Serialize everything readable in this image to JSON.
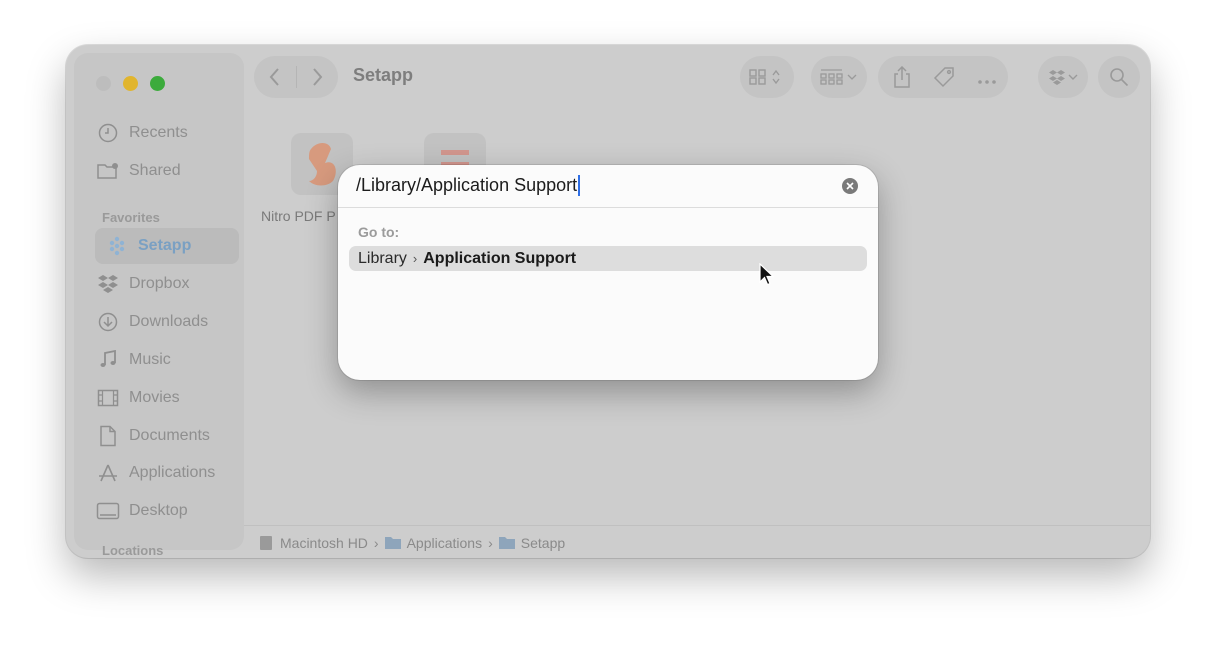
{
  "window": {
    "title": "Setapp",
    "colors": {
      "close": "#bdbdbd",
      "minimize": "#e1b52e",
      "maximize": "#3cab3c"
    }
  },
  "sidebar": {
    "items_top": [
      {
        "label": "Recents",
        "icon": "clock-icon"
      },
      {
        "label": "Shared",
        "icon": "shared-folder-icon"
      }
    ],
    "favorites_header": "Favorites",
    "favorites": [
      {
        "label": "Setapp",
        "icon": "setapp-icon",
        "active": true
      },
      {
        "label": "Dropbox",
        "icon": "dropbox-icon"
      },
      {
        "label": "Downloads",
        "icon": "download-icon"
      },
      {
        "label": "Music",
        "icon": "music-note-icon"
      },
      {
        "label": "Movies",
        "icon": "film-icon"
      },
      {
        "label": "Documents",
        "icon": "document-icon"
      },
      {
        "label": "Applications",
        "icon": "applications-icon"
      },
      {
        "label": "Desktop",
        "icon": "desktop-icon"
      }
    ],
    "locations_header": "Locations"
  },
  "files": [
    {
      "label": "Nitro PDF P",
      "icon": "nitro-pdf-icon"
    },
    {
      "label": "",
      "icon": "app-icon"
    }
  ],
  "pathbar": [
    {
      "label": "Macintosh HD",
      "icon": "disk-icon"
    },
    {
      "label": "Applications",
      "icon": "folder-icon"
    },
    {
      "label": "Setapp",
      "icon": "folder-icon"
    }
  ],
  "goto_dialog": {
    "input_value": "/Library/Application Support",
    "goto_label": "Go to:",
    "result": {
      "parent": "Library",
      "leaf": "Application Support"
    }
  }
}
